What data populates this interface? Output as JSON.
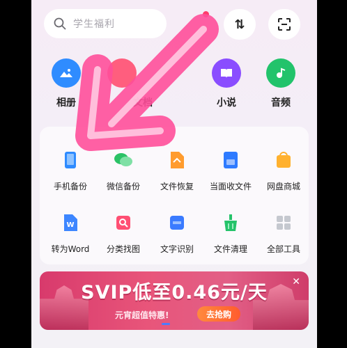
{
  "search": {
    "placeholder": "学生福利"
  },
  "header": {
    "sort_glyph": "⇅"
  },
  "top_row": [
    {
      "label": "相册",
      "icon": "photo-icon",
      "color": "#2f8cff"
    },
    {
      "label": "文档",
      "icon": "document-icon",
      "color": "#ff5e7e"
    },
    {
      "label": "小说",
      "icon": "book-icon",
      "color": "#8a4dff"
    },
    {
      "label": "音频",
      "icon": "music-icon",
      "color": "#22c36b"
    }
  ],
  "tools": [
    {
      "label": "手机备份",
      "icon": "phone-backup-icon",
      "color": "#2e8bff"
    },
    {
      "label": "微信备份",
      "icon": "wechat-backup-icon",
      "color": "#2bc266"
    },
    {
      "label": "文件恢复",
      "icon": "file-recovery-icon",
      "color": "#ff9c2e"
    },
    {
      "label": "当面收文件",
      "icon": "receive-files-icon",
      "color": "#2e7bff"
    },
    {
      "label": "网盘商城",
      "icon": "store-icon",
      "color": "#ffb12e"
    },
    {
      "label": "转为Word",
      "icon": "word-convert-icon",
      "color": "#3d86ff"
    },
    {
      "label": "分类找图",
      "icon": "image-classify-icon",
      "color": "#ff4f73"
    },
    {
      "label": "文字识别",
      "icon": "ocr-icon",
      "color": "#3a7bff"
    },
    {
      "label": "文件清理",
      "icon": "file-cleanup-icon",
      "color": "#25c36a"
    },
    {
      "label": "全部工具",
      "icon": "all-tools-icon",
      "color": "#9aa0ab"
    }
  ],
  "banner": {
    "title": "SVIP低至0.46元/天",
    "subtitle": "元宵超值特惠!",
    "button": "去抢购"
  },
  "colors": {
    "arrow": "#ff4f9a",
    "accent": "#4b7cff"
  }
}
